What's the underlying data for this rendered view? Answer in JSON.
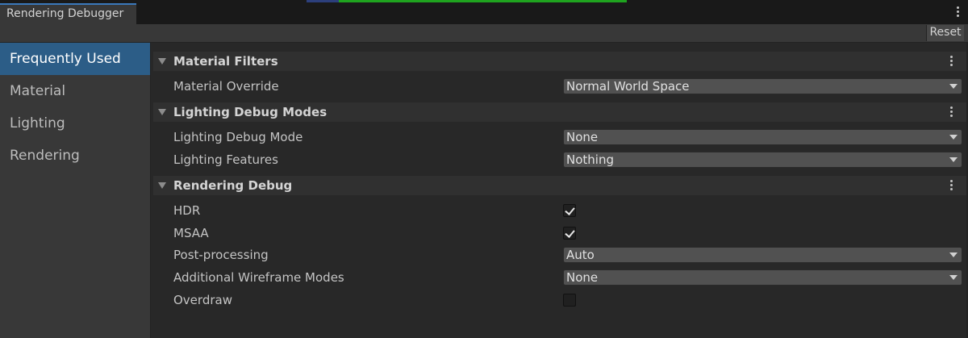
{
  "window": {
    "tab_title": "Rendering Debugger"
  },
  "toolbar": {
    "reset_label": "Reset"
  },
  "sidebar": {
    "items": [
      {
        "label": "Frequently Used",
        "active": true
      },
      {
        "label": "Material",
        "active": false
      },
      {
        "label": "Lighting",
        "active": false
      },
      {
        "label": "Rendering",
        "active": false
      }
    ]
  },
  "sections": {
    "material_filters": {
      "title": "Material Filters",
      "material_override": {
        "label": "Material Override",
        "value": "Normal World Space"
      }
    },
    "lighting_debug_modes": {
      "title": "Lighting Debug Modes",
      "lighting_debug_mode": {
        "label": "Lighting Debug Mode",
        "value": "None"
      },
      "lighting_features": {
        "label": "Lighting Features",
        "value": "Nothing"
      }
    },
    "rendering_debug": {
      "title": "Rendering Debug",
      "hdr": {
        "label": "HDR",
        "checked": true
      },
      "msaa": {
        "label": "MSAA",
        "checked": true
      },
      "post_processing": {
        "label": "Post-processing",
        "value": "Auto"
      },
      "additional_wireframe_modes": {
        "label": "Additional Wireframe Modes",
        "value": "None"
      },
      "overdraw": {
        "label": "Overdraw",
        "checked": false
      }
    }
  },
  "icons": {
    "tab_menu": "kebab-menu-icon",
    "section_menu": "kebab-menu-icon",
    "foldout": "foldout-triangle-icon",
    "dropdown": "dropdown-arrow-icon",
    "check": "checkmark-icon"
  },
  "colors": {
    "background": "#282828",
    "sidebar": "#383838",
    "selected": "#2c5d87",
    "section_header": "#303030",
    "dropdown": "#515151"
  }
}
